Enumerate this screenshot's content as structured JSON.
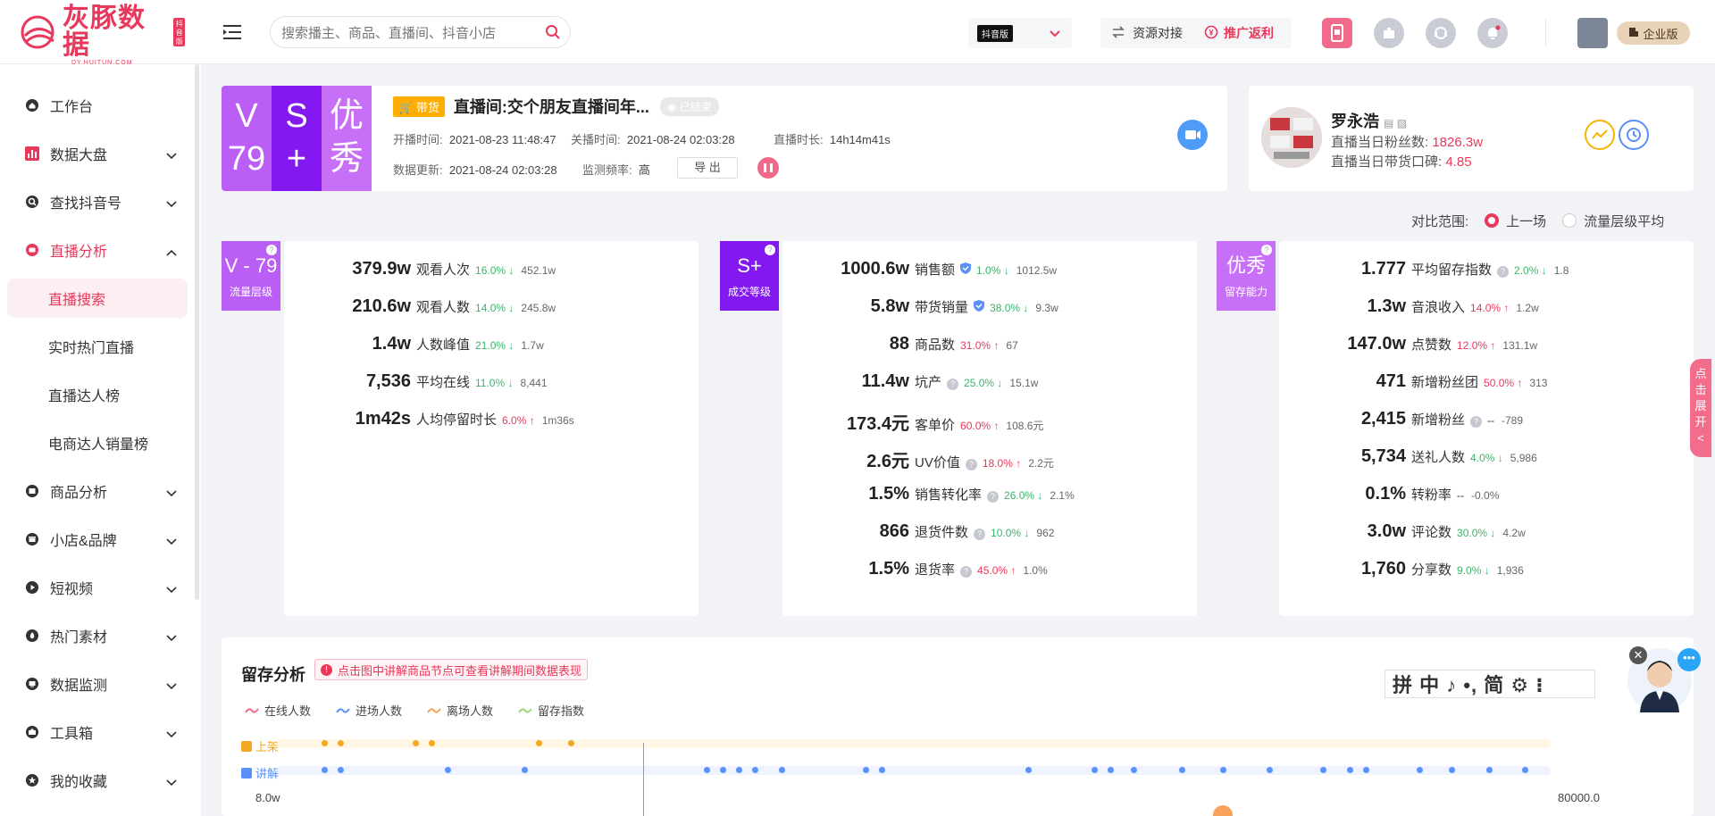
{
  "header": {
    "brand": "灰豚数据",
    "brand_sub": "DY.HUITUN.COM",
    "brand_tag": "抖音版",
    "search_placeholder": "搜索播主、商品、直播间、抖音小店",
    "platform_tag": "抖音版",
    "resource_label": "资源对接",
    "promo_label": "推广返利",
    "enterprise_label": "企业版"
  },
  "sidebar": {
    "items": [
      {
        "label": "工作台",
        "icon": "home-icon"
      },
      {
        "label": "数据大盘",
        "icon": "bar-chart-icon"
      },
      {
        "label": "查找抖音号",
        "icon": "search-icon"
      },
      {
        "label": "直播分析",
        "icon": "live-icon"
      },
      {
        "label": "商品分析",
        "icon": "product-icon"
      },
      {
        "label": "小店&品牌",
        "icon": "shop-icon"
      },
      {
        "label": "短视频",
        "icon": "video-icon"
      },
      {
        "label": "热门素材",
        "icon": "fire-icon"
      },
      {
        "label": "数据监测",
        "icon": "monitor-icon"
      },
      {
        "label": "工具箱",
        "icon": "toolbox-icon"
      },
      {
        "label": "我的收藏",
        "icon": "star-icon"
      }
    ],
    "sub_items": [
      "直播搜索",
      "实时热门直播",
      "直播达人榜",
      "电商达人销量榜"
    ]
  },
  "live": {
    "grade1": [
      "V",
      "79"
    ],
    "grade2": [
      "S",
      "+"
    ],
    "grade3": [
      "优",
      "秀"
    ],
    "badge": "带货",
    "title": "直播间:交个朋友直播间年...",
    "status": "已结束",
    "start_label": "开播时间:",
    "start_value": "2021-08-23 11:48:47",
    "end_label": "关播时间:",
    "end_value": "2021-08-24 02:03:28",
    "duration_label": "直播时长:",
    "duration_value": "14h14m41s",
    "update_label": "数据更新:",
    "update_value": "2021-08-24 02:03:28",
    "freq_label": "监测频率:",
    "freq_value": "高",
    "export_label": "导 出"
  },
  "anchor": {
    "name": "罗永浩",
    "fans_label": "直播当日粉丝数:",
    "fans_value": "1826.3w",
    "rating_label": "直播当日带货口碑:",
    "rating_value": "4.85"
  },
  "compare": {
    "label": "对比范围:",
    "option1": "上一场",
    "option2": "流量层级平均"
  },
  "panels": [
    {
      "tag_big": "V - 79",
      "tag_small": "流量层级",
      "color": "#bb5ef5",
      "rows": [
        {
          "v": "379.9w",
          "label": "观看人次",
          "pct": "16.0%",
          "dir": "down",
          "base": "452.1w"
        },
        {
          "v": "210.6w",
          "label": "观看人数",
          "pct": "14.0%",
          "dir": "down",
          "base": "245.8w"
        },
        {
          "v": "1.4w",
          "label": "人数峰值",
          "pct": "21.0%",
          "dir": "down",
          "base": "1.7w"
        },
        {
          "v": "7,536",
          "label": "平均在线",
          "pct": "11.0%",
          "dir": "down",
          "base": "8,441"
        },
        {
          "v": "1m42s",
          "label": "人均停留时长",
          "pct": "6.0%",
          "dir": "up",
          "base": "1m36s"
        }
      ]
    },
    {
      "tag_big": "S+",
      "tag_small": "成交等级",
      "color": "#8319f0",
      "rows": [
        {
          "v": "1000.6w",
          "label": "销售额",
          "pct": "1.0%",
          "dir": "down",
          "base": "1012.5w",
          "shield": true
        },
        {
          "v": "5.8w",
          "label": "带货销量",
          "pct": "38.0%",
          "dir": "down",
          "base": "9.3w",
          "shield": true
        },
        {
          "v": "88",
          "label": "商品数",
          "pct": "31.0%",
          "dir": "up",
          "base": "67"
        },
        {
          "v": "11.4w",
          "label": "坑产",
          "pct": "25.0%",
          "dir": "down",
          "base": "15.1w",
          "q": true
        },
        {
          "v": "173.4元",
          "label": "客单价",
          "pct": "60.0%",
          "dir": "up",
          "base": "108.6元"
        },
        {
          "v": "2.6元",
          "label": "UV价值",
          "pct": "18.0%",
          "dir": "up",
          "base": "2.2元",
          "q": true
        },
        {
          "v": "1.5%",
          "label": "销售转化率",
          "pct": "26.0%",
          "dir": "down",
          "base": "2.1%",
          "q": true
        },
        {
          "v": "866",
          "label": "退货件数",
          "pct": "10.0%",
          "dir": "down",
          "base": "962",
          "q": true
        },
        {
          "v": "1.5%",
          "label": "退货率",
          "pct": "45.0%",
          "dir": "up",
          "base": "1.0%",
          "q": true
        }
      ]
    },
    {
      "tag_big": "优秀",
      "tag_small": "留存能力",
      "color": "#c86ff7",
      "rows": [
        {
          "v": "1.777",
          "label": "平均留存指数",
          "pct": "2.0%",
          "dir": "down",
          "base": "1.8",
          "q": true
        },
        {
          "v": "1.3w",
          "label": "音浪收入",
          "pct": "14.0%",
          "dir": "up",
          "base": "1.2w"
        },
        {
          "v": "147.0w",
          "label": "点赞数",
          "pct": "12.0%",
          "dir": "up",
          "base": "131.1w"
        },
        {
          "v": "471",
          "label": "新增粉丝团",
          "pct": "50.0%",
          "dir": "up",
          "base": "313"
        },
        {
          "v": "2,415",
          "label": "新增粉丝",
          "pct": "--",
          "dir": "none",
          "base": "-789",
          "q": true
        },
        {
          "v": "5,734",
          "label": "送礼人数",
          "pct": "4.0%",
          "dir": "down",
          "base": "5,986"
        },
        {
          "v": "0.1%",
          "label": "转粉率",
          "pct": "--",
          "dir": "none",
          "base": "-0.0%"
        },
        {
          "v": "3.0w",
          "label": "评论数",
          "pct": "30.0%",
          "dir": "down",
          "base": "4.2w"
        },
        {
          "v": "1,760",
          "label": "分享数",
          "pct": "9.0%",
          "dir": "down",
          "base": "1,936"
        }
      ]
    }
  ],
  "expand": [
    "点",
    "击",
    "展",
    "开",
    "<"
  ],
  "retention": {
    "title": "留存分析",
    "tip": "点击图中讲解商品节点可查看讲解期间数据表现",
    "legend": [
      {
        "label": "在线人数",
        "color": "#f06a8a"
      },
      {
        "label": "进场人数",
        "color": "#5b8ff9"
      },
      {
        "label": "离场人数",
        "color": "#f7a35c"
      },
      {
        "label": "留存指数",
        "color": "#9bd67b"
      }
    ],
    "track1_label": "上架",
    "track2_label": "讲解",
    "y_left": "8.0w",
    "y_right": "80000.0",
    "ime": "拼 中 ♪ •, 简 ⚙ ⁝"
  }
}
